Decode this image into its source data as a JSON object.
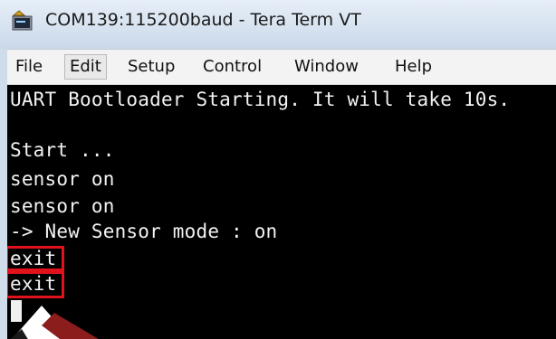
{
  "window": {
    "title": "COM139:115200baud - Tera Term VT",
    "icon": "tera-term-app-icon"
  },
  "menu": {
    "items": [
      {
        "label": "File"
      },
      {
        "label": "Edit"
      },
      {
        "label": "Setup"
      },
      {
        "label": "Control"
      },
      {
        "label": "Window"
      },
      {
        "label": "Help"
      }
    ],
    "active": "Edit"
  },
  "terminal": {
    "lines": [
      "UART Bootloader Starting. It will take 10s.",
      "",
      "Start ...",
      "sensor on",
      "sensor on",
      "-> New Sensor mode : on",
      "exit",
      "exit"
    ],
    "highlighted_lines": [
      "exit",
      "exit"
    ],
    "highlight_color": "#e1121b",
    "background_color": "#000000",
    "text_color": "#f2f2f2"
  }
}
